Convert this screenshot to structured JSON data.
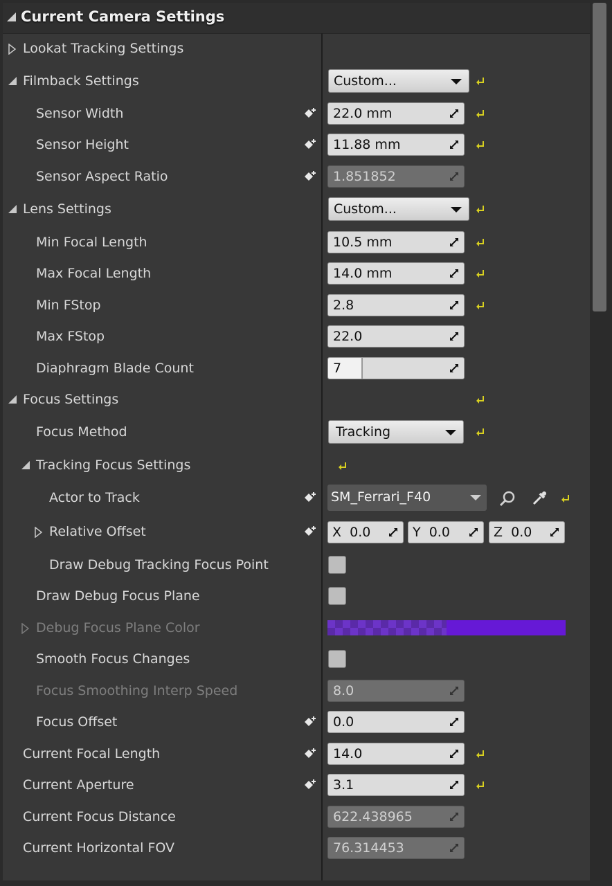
{
  "panel": {
    "title": "Current Camera Settings"
  },
  "sections": {
    "lookat": "Lookat Tracking Settings",
    "filmback": "Filmback Settings",
    "lens": "Lens Settings",
    "focus": "Focus Settings",
    "tracking_focus": "Tracking Focus Settings"
  },
  "filmback": {
    "preset": "Custom...",
    "sensor_width_label": "Sensor Width",
    "sensor_width": "22.0 mm",
    "sensor_height_label": "Sensor Height",
    "sensor_height": "11.88 mm",
    "aspect_label": "Sensor Aspect Ratio",
    "aspect": "1.851852"
  },
  "lens": {
    "preset": "Custom...",
    "min_focal_label": "Min Focal Length",
    "min_focal": "10.5 mm",
    "max_focal_label": "Max Focal Length",
    "max_focal": "14.0 mm",
    "min_fstop_label": "Min FStop",
    "min_fstop": "2.8",
    "max_fstop_label": "Max FStop",
    "max_fstop": "22.0",
    "blade_label": "Diaphragm Blade Count",
    "blade": "7"
  },
  "focus": {
    "method_label": "Focus Method",
    "method": "Tracking",
    "actor_label": "Actor to Track",
    "actor": "SM_Ferrari_F40",
    "offset_label": "Relative Offset",
    "offset_x_label": "X",
    "offset_x": "0.0",
    "offset_y_label": "Y",
    "offset_y": "0.0",
    "offset_z_label": "Z",
    "offset_z": "0.0",
    "debug_point_label": "Draw Debug Tracking Focus Point",
    "debug_plane_label": "Draw Debug Focus Plane",
    "plane_color_label": "Debug Focus Plane Color",
    "plane_color": "#6619d6",
    "smooth_label": "Smooth Focus Changes",
    "interp_label": "Focus Smoothing Interp Speed",
    "interp": "8.0",
    "focus_offset_label": "Focus Offset",
    "focus_offset": "0.0"
  },
  "current": {
    "focal_label": "Current Focal Length",
    "focal": "14.0",
    "aperture_label": "Current Aperture",
    "aperture": "3.1",
    "distance_label": "Current Focus Distance",
    "distance": "622.438965",
    "hfov_label": "Current Horizontal FOV",
    "hfov": "76.314453"
  },
  "icons": {
    "expanded": "triangle-down-icon",
    "collapsed": "triangle-right-icon",
    "reset": "reset-to-default-icon",
    "keyframe": "keyframe-icon",
    "browse": "magnifier-icon",
    "pick": "eyedropper-icon"
  },
  "colors": {
    "reset_icon": "#d8d020",
    "panel": "#383838"
  }
}
